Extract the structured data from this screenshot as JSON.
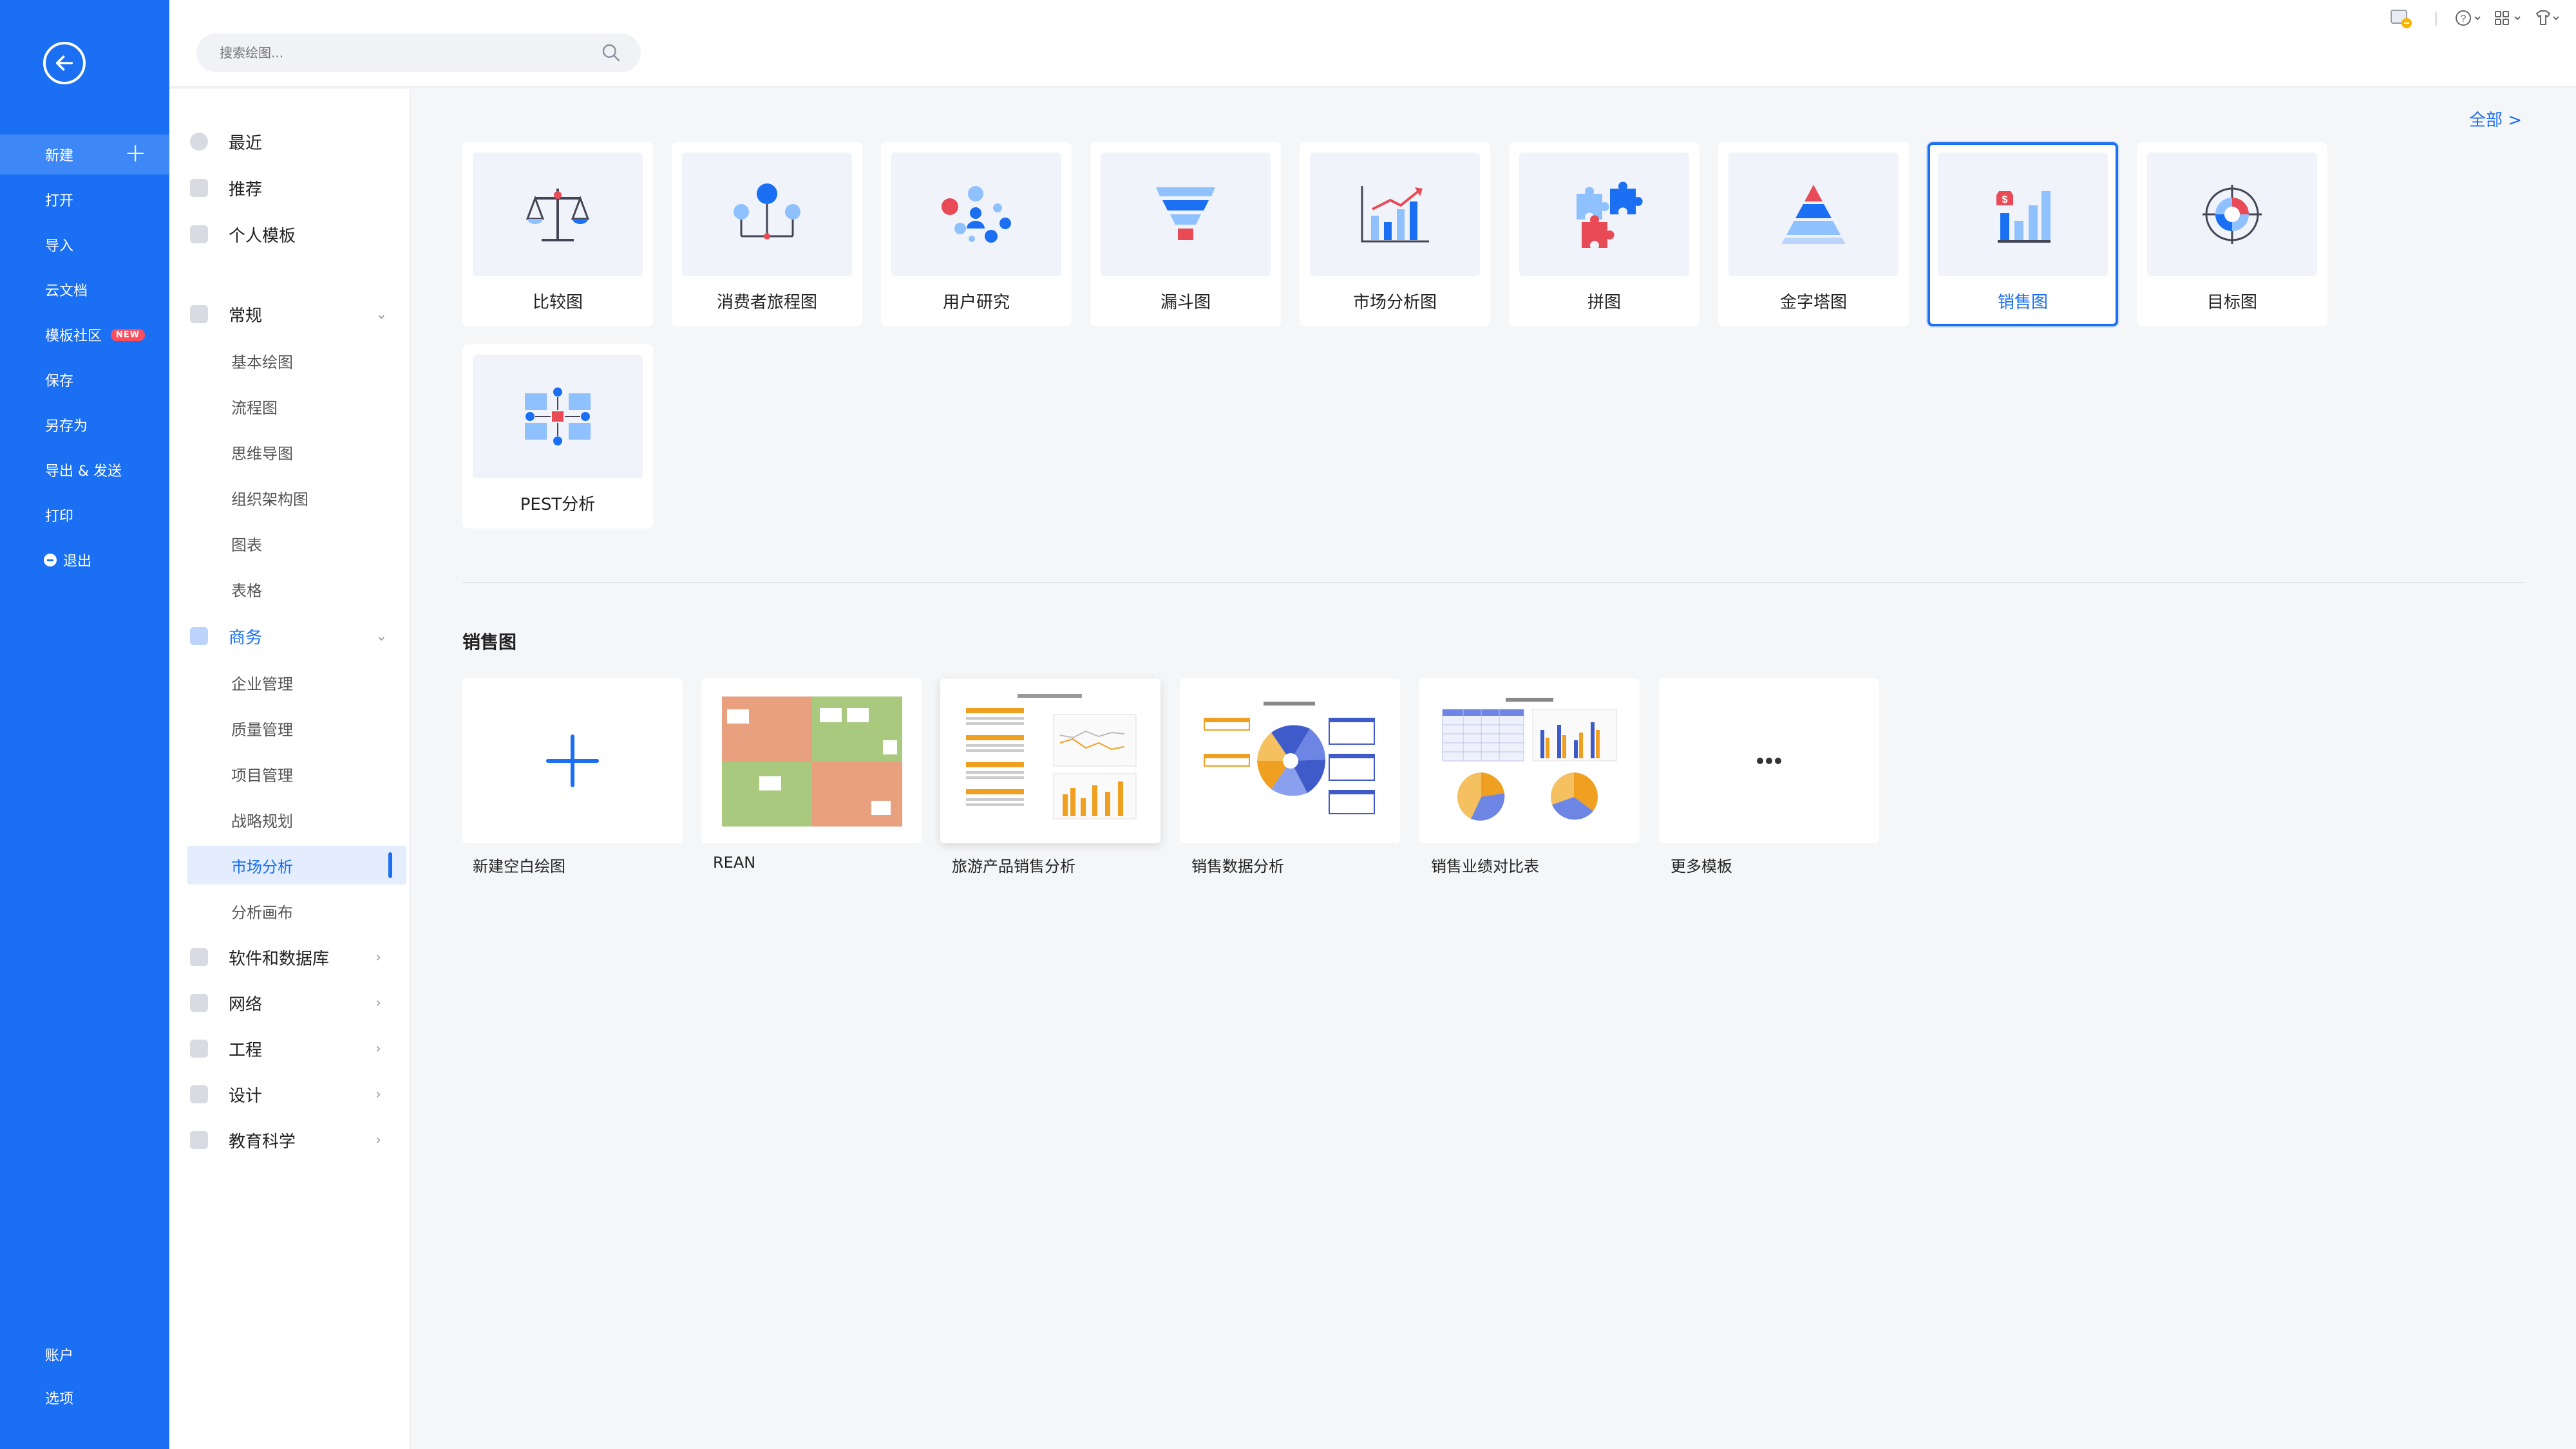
{
  "sidebar": {
    "items": [
      {
        "label": "新建"
      },
      {
        "label": "打开"
      },
      {
        "label": "导入"
      },
      {
        "label": "云文档"
      },
      {
        "label": "模板社区",
        "badge": "NEW"
      },
      {
        "label": "保存"
      },
      {
        "label": "另存为"
      },
      {
        "label": "导出 & 发送"
      },
      {
        "label": "打印"
      },
      {
        "label": "退出"
      }
    ],
    "bottom": [
      {
        "label": "账户"
      },
      {
        "label": "选项"
      }
    ]
  },
  "search": {
    "placeholder": "搜索绘图..."
  },
  "categories": {
    "top": [
      {
        "label": "最近"
      },
      {
        "label": "推荐"
      },
      {
        "label": "个人模板"
      }
    ],
    "general": {
      "label": "常规",
      "subs": [
        {
          "label": "基本绘图"
        },
        {
          "label": "流程图"
        },
        {
          "label": "思维导图"
        },
        {
          "label": "组织架构图"
        },
        {
          "label": "图表"
        },
        {
          "label": "表格"
        }
      ]
    },
    "business": {
      "label": "商务",
      "subs": [
        {
          "label": "企业管理"
        },
        {
          "label": "质量管理"
        },
        {
          "label": "项目管理"
        },
        {
          "label": "战略规划"
        },
        {
          "label": "市场分析"
        },
        {
          "label": "分析画布"
        }
      ]
    },
    "others": [
      {
        "label": "软件和数据库"
      },
      {
        "label": "网络"
      },
      {
        "label": "工程"
      },
      {
        "label": "设计"
      },
      {
        "label": "教育科学"
      }
    ]
  },
  "main": {
    "all_link": "全部  >",
    "types": [
      {
        "label": "比较图"
      },
      {
        "label": "消费者旅程图"
      },
      {
        "label": "用户研究"
      },
      {
        "label": "漏斗图"
      },
      {
        "label": "市场分析图"
      },
      {
        "label": "拼图"
      },
      {
        "label": "金字塔图"
      },
      {
        "label": "销售图"
      },
      {
        "label": "目标图"
      },
      {
        "label": "PEST分析"
      }
    ],
    "section_title": "销售图",
    "templates": [
      {
        "label": "新建空白绘图"
      },
      {
        "label": "REAN"
      },
      {
        "label": "旅游产品销售分析"
      },
      {
        "label": "销售数据分析"
      },
      {
        "label": "销售业绩对比表"
      },
      {
        "label": "更多模板"
      }
    ]
  },
  "colors": {
    "primary": "#1a6ff3",
    "active_bg": "#3d87f6",
    "highlight": "#e3edfd"
  }
}
